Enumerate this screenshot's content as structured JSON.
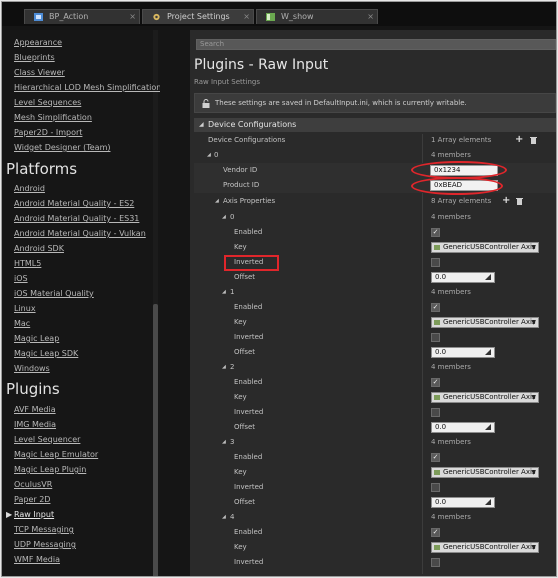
{
  "tabs": [
    {
      "label": "BP_Action"
    },
    {
      "label": "Project Settings"
    },
    {
      "label": "W_show"
    }
  ],
  "sidebar": {
    "group1_items": [
      "Appearance",
      "Blueprints",
      "Class Viewer",
      "Hierarchical LOD Mesh Simplification",
      "Level Sequences",
      "Mesh Simplification",
      "Paper2D - Import",
      "Widget Designer (Team)"
    ],
    "platforms_heading": "Platforms",
    "platforms_items": [
      "Android",
      "Android Material Quality - ES2",
      "Android Material Quality - ES31",
      "Android Material Quality - Vulkan",
      "Android SDK",
      "HTML5",
      "iOS",
      "iOS Material Quality",
      "Linux",
      "Mac",
      "Magic Leap",
      "Magic Leap SDK",
      "Windows"
    ],
    "plugins_heading": "Plugins",
    "plugins_items": [
      "AVF Media",
      "IMG Media",
      "Level Sequencer",
      "Magic Leap Emulator",
      "Magic Leap Plugin",
      "OculusVR",
      "Paper 2D",
      "Raw Input",
      "TCP Messaging",
      "UDP Messaging",
      "WMF Media"
    ],
    "selected": "Raw Input"
  },
  "search": {
    "placeholder": "Search"
  },
  "page": {
    "title": "Plugins - Raw Input",
    "subtitle": "Raw Input Settings",
    "notice": "These settings are saved in DefaultInput.ini, which is currently writable."
  },
  "section": {
    "title": "Device Configurations"
  },
  "device_config": {
    "label": "Device Configurations",
    "count": "1 Array elements",
    "index": "0",
    "members": "4 members",
    "vendor_label": "Vendor ID",
    "vendor_value": "0x1234",
    "product_label": "Product ID",
    "product_value": "0xBEAD",
    "axis_label": "Axis Properties",
    "axis_count": "8 Array elements"
  },
  "axes": [
    {
      "index": "0",
      "members": "4 members",
      "enabled_label": "Enabled",
      "enabled": true,
      "key_label": "Key",
      "key": "GenericUSBController Axis 1",
      "inverted_label": "Inverted",
      "inverted": false,
      "offset_label": "Offset",
      "offset": "0.0"
    },
    {
      "index": "1",
      "members": "4 members",
      "enabled_label": "Enabled",
      "enabled": true,
      "key_label": "Key",
      "key": "GenericUSBController Axis 2",
      "inverted_label": "Inverted",
      "inverted": false,
      "offset_label": "Offset",
      "offset": "0.0"
    },
    {
      "index": "2",
      "members": "4 members",
      "enabled_label": "Enabled",
      "enabled": true,
      "key_label": "Key",
      "key": "GenericUSBController Axis 3",
      "inverted_label": "Inverted",
      "inverted": false,
      "offset_label": "Offset",
      "offset": "0.0"
    },
    {
      "index": "3",
      "members": "4 members",
      "enabled_label": "Enabled",
      "enabled": true,
      "key_label": "Key",
      "key": "GenericUSBController Axis 4",
      "inverted_label": "Inverted",
      "inverted": false,
      "offset_label": "Offset",
      "offset": "0.0"
    },
    {
      "index": "4",
      "members": "4 members",
      "enabled_label": "Enabled",
      "enabled": true,
      "key_label": "Key",
      "key": "GenericUSBController Axis 5",
      "inverted_label": "Inverted",
      "inverted": false
    }
  ],
  "icons": {
    "tab_blueprint": "blueprint-icon",
    "tab_settings": "gear-icon",
    "tab_widget": "widget-icon",
    "notice": "lock-icon",
    "add": "plus-icon",
    "remove": "trash-icon",
    "key_combo": "key-icon"
  },
  "colors": {
    "accent_highlight": "#e0262b",
    "panel": "#2a2a2a",
    "sidebar": "#161616"
  }
}
